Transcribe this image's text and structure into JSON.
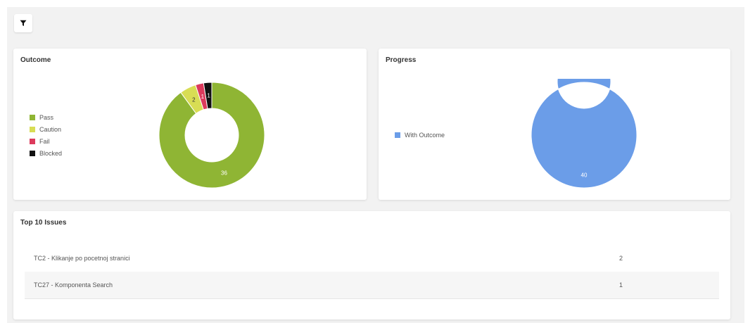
{
  "filter": {
    "icon": "filter-icon"
  },
  "outcome": {
    "title": "Outcome",
    "legend": [
      {
        "label": "Pass",
        "color": "#8fb534"
      },
      {
        "label": "Caution",
        "color": "#d8dd54"
      },
      {
        "label": "Fail",
        "color": "#dc3a5c"
      },
      {
        "label": "Blocked",
        "color": "#111111"
      }
    ]
  },
  "progress": {
    "title": "Progress",
    "legend": [
      {
        "label": "With Outcome",
        "color": "#6b9de8"
      }
    ]
  },
  "issues": {
    "title": "Top 10 Issues",
    "rows": [
      {
        "name": "TC2 - Klikanje po pocetnoj stranici",
        "count": "2"
      },
      {
        "name": "TC27 - Komponenta Search",
        "count": "1"
      }
    ]
  },
  "chart_data": [
    {
      "type": "pie",
      "title": "Outcome",
      "categories": [
        "Pass",
        "Caution",
        "Fail",
        "Blocked"
      ],
      "values": [
        36,
        2,
        1,
        1
      ],
      "colors": [
        "#8fb534",
        "#d8dd54",
        "#dc3a5c",
        "#111111"
      ],
      "legend": "left"
    },
    {
      "type": "pie",
      "title": "Progress",
      "categories": [
        "With Outcome"
      ],
      "values": [
        40
      ],
      "colors": [
        "#6b9de8"
      ],
      "legend": "left"
    }
  ]
}
